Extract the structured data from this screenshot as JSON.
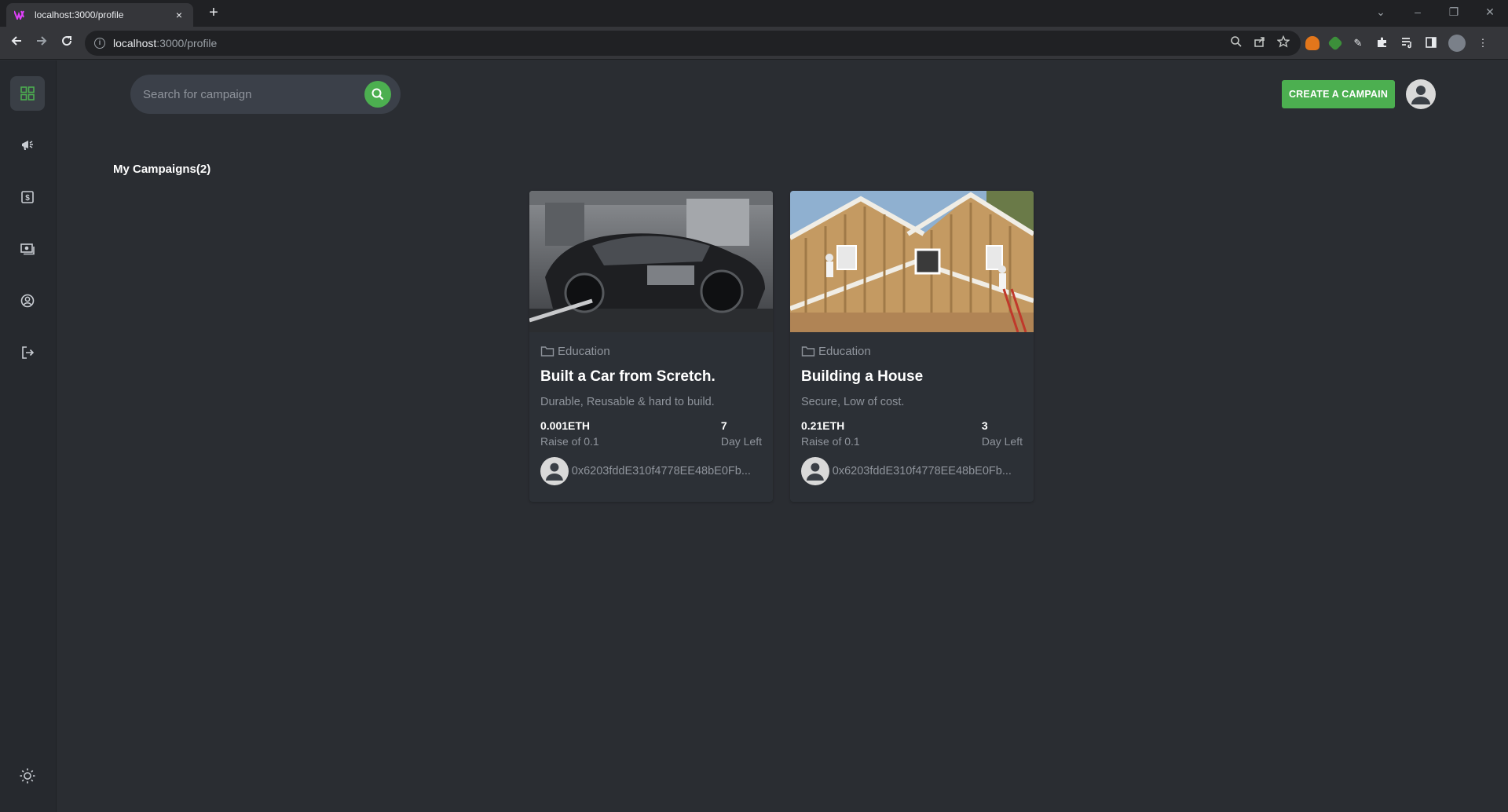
{
  "browser": {
    "tab_title": "localhost:3000/profile",
    "new_tab_glyph": "+",
    "close_glyph": "×",
    "url_host": "localhost",
    "url_path": ":3000/profile"
  },
  "search": {
    "placeholder": "Search for campaign"
  },
  "header": {
    "create_label": "CREATE A CAMPAIN"
  },
  "section": {
    "title": "My Campaigns(2)"
  },
  "campaigns": [
    {
      "category": "Education",
      "title": "Built a Car from Scretch.",
      "description": "Durable, Reusable & hard to build.",
      "amount": "0.001ETH",
      "raise_label": "Raise of 0.1",
      "days": "7",
      "days_label": "Day Left",
      "owner": "0x6203fddE310f4778EE48bE0Fb..."
    },
    {
      "category": "Education",
      "title": "Building a House",
      "description": "Secure, Low of cost.",
      "amount": "0.21ETH",
      "raise_label": "Raise of 0.1",
      "days": "3",
      "days_label": "Day Left",
      "owner": "0x6203fddE310f4778EE48bE0Fb..."
    }
  ],
  "sidebar": {
    "items": [
      "dashboard-icon",
      "campaign-icon",
      "payment-icon",
      "withdraw-icon",
      "profile-icon",
      "logout-icon"
    ]
  },
  "colors": {
    "accent": "#4caf50",
    "background": "#2a2d32",
    "sidebar": "#26292e"
  }
}
